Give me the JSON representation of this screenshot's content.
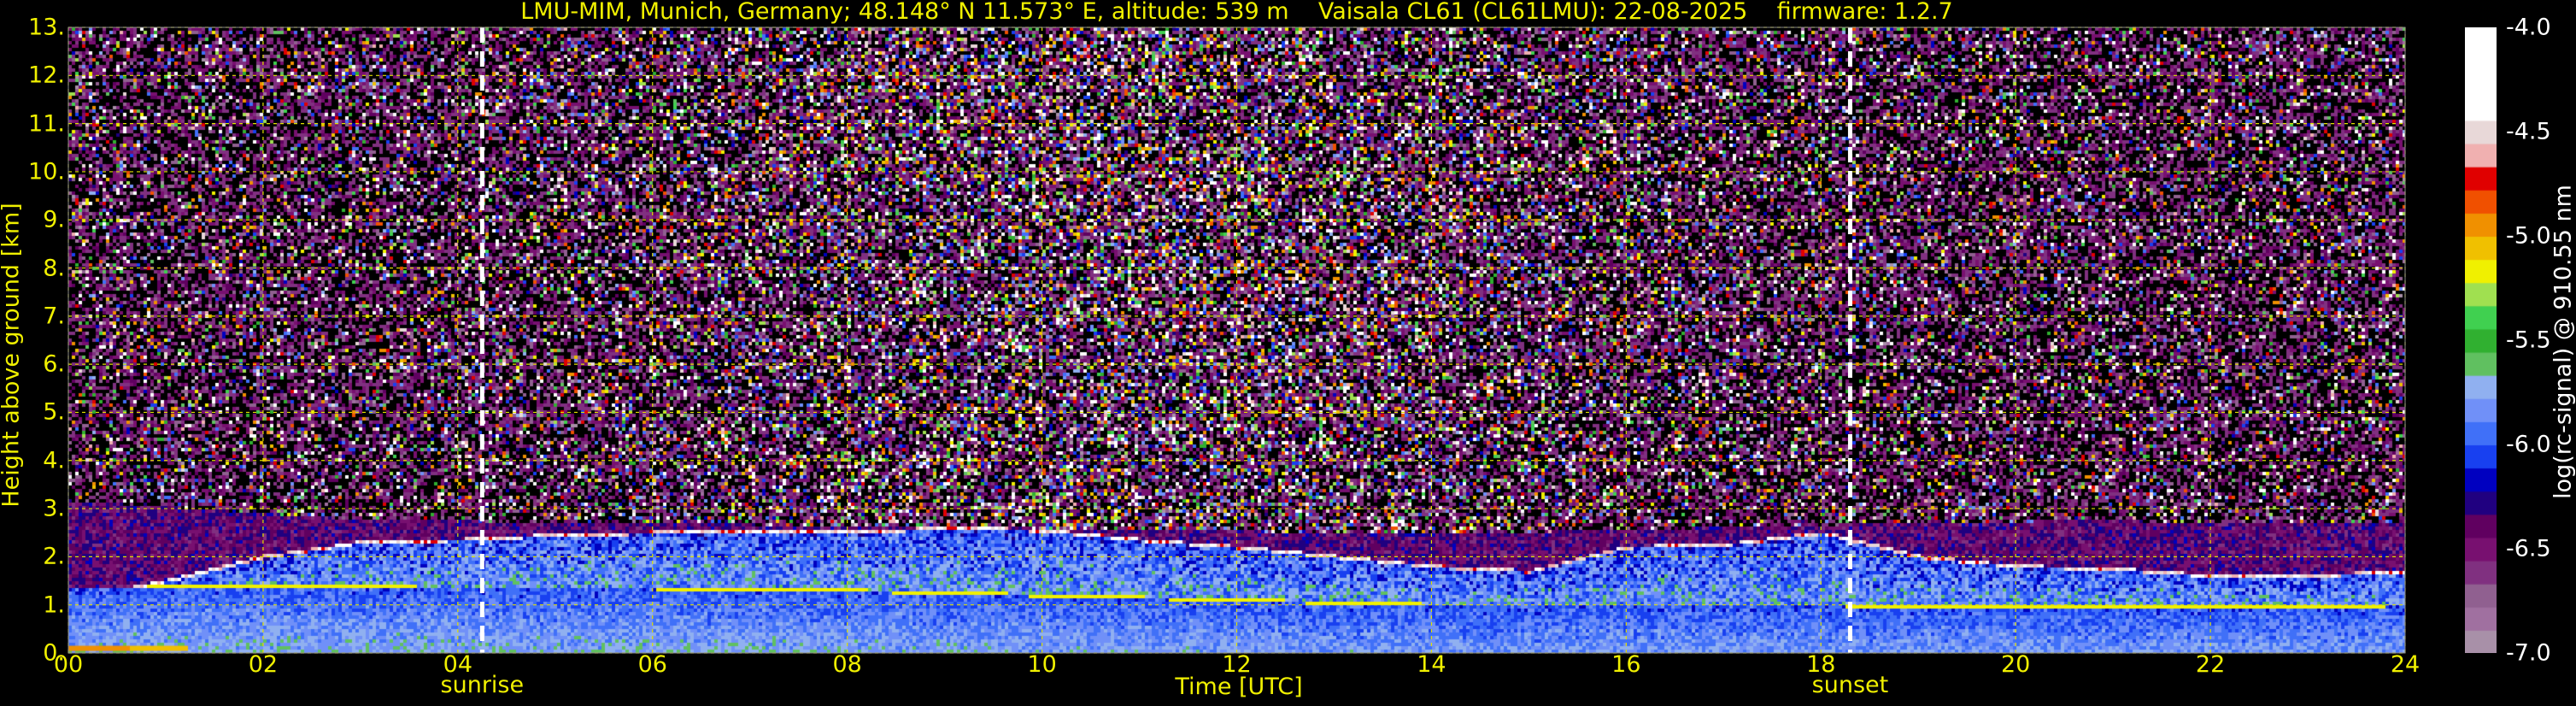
{
  "chart_data": {
    "type": "heatmap",
    "title": "LMU-MIM, Munich, Germany; 48.148° N 11.573° E, altitude: 539 m    Vaisala CL61 (CL61LMU): 22-08-2025    firmware: 1.2.7",
    "xlabel": "Time [UTC]",
    "ylabel": "Height above ground [km]",
    "xlim": [
      0,
      24
    ],
    "ylim": [
      0,
      13
    ],
    "x_ticks": [
      "00",
      "02",
      "04",
      "06",
      "08",
      "10",
      "12",
      "14",
      "16",
      "18",
      "20",
      "22",
      "24"
    ],
    "y_ticks": [
      "0.",
      "1.",
      "2.",
      "3.",
      "4.",
      "5.",
      "6.",
      "7.",
      "8.",
      "9.",
      "10.",
      "11.",
      "12.",
      "13."
    ],
    "grid": true,
    "grid_color": "#e0e000",
    "markers": [
      {
        "label": "sunrise",
        "time": 4.25
      },
      {
        "label": "sunset",
        "time": 18.3
      }
    ],
    "colorbar": {
      "label": "log(rc-signal) @ 910.55 nm",
      "range": [
        -7.0,
        -4.0
      ],
      "ticks": [
        "-4.0",
        "-4.5",
        "-5.0",
        "-5.5",
        "-6.0",
        "-6.5",
        "-7.0"
      ],
      "colors": [
        "#a890a8",
        "#a070a0",
        "#906090",
        "#803080",
        "#781070",
        "#600060",
        "#200080",
        "#0000c0",
        "#1840f0",
        "#4070f8",
        "#7090f8",
        "#90b0f0",
        "#60c060",
        "#30b030",
        "#40d050",
        "#a0e050",
        "#f0f000",
        "#f0c000",
        "#f09000",
        "#f05000",
        "#e00000",
        "#f0b0b0",
        "#e8d8d8",
        "#ffffff",
        "#ffffff",
        "#ffffff",
        "#ffffff"
      ]
    },
    "layers": {
      "boundary_layer_top_km": [
        [
          0,
          1.1
        ],
        [
          1,
          1.5
        ],
        [
          2,
          2.0
        ],
        [
          3,
          2.3
        ],
        [
          4,
          2.35
        ],
        [
          5,
          2.45
        ],
        [
          6,
          2.5
        ],
        [
          7,
          2.55
        ],
        [
          8,
          2.5
        ],
        [
          9,
          2.6
        ],
        [
          10,
          2.55
        ],
        [
          11,
          2.35
        ],
        [
          12,
          2.2
        ],
        [
          13,
          2.0
        ],
        [
          14,
          1.8
        ],
        [
          15,
          1.7
        ],
        [
          16,
          2.2
        ],
        [
          17,
          2.25
        ],
        [
          18,
          2.5
        ],
        [
          19,
          2.0
        ],
        [
          20,
          1.8
        ],
        [
          21,
          1.75
        ],
        [
          22,
          1.6
        ],
        [
          23,
          1.6
        ],
        [
          24,
          1.7
        ]
      ],
      "residual_layer_top_km": [
        [
          0,
          1.35
        ],
        [
          2,
          1.4
        ],
        [
          4,
          1.35
        ],
        [
          6,
          1.35
        ],
        [
          8,
          1.3
        ],
        [
          10,
          1.2
        ],
        [
          12,
          1.1
        ],
        [
          14,
          1.0
        ],
        [
          16,
          1.0
        ],
        [
          18,
          1.0
        ],
        [
          20,
          0.95
        ],
        [
          22,
          0.95
        ],
        [
          24,
          1.0
        ]
      ],
      "cloud_tops_km": [
        [
          0,
          3.2
        ],
        [
          3,
          2.8
        ],
        [
          11,
          2.6
        ],
        [
          14,
          2.5
        ],
        [
          18.2,
          2.7
        ],
        [
          21,
          2.8
        ],
        [
          22,
          2.7
        ]
      ]
    }
  }
}
